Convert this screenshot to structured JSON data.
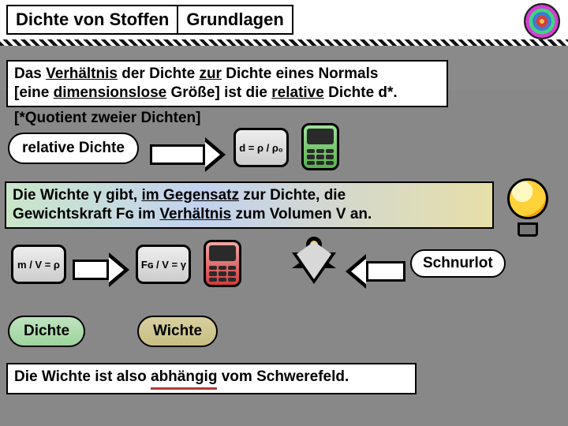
{
  "header": {
    "title_left": "Dichte von Stoffen",
    "title_right": "Grundlagen"
  },
  "intro": {
    "line1_a": "Das ",
    "line1_b": "Verhältnis",
    "line1_c": " der Dichte ",
    "line1_d": "zur",
    "line1_e": " Dichte eines Normals",
    "line2_a": "[eine ",
    "line2_b": "dimensionslose",
    "line2_c": " Größe] ist die ",
    "line2_d": "relative",
    "line2_e": " Dichte d*.",
    "line3": "[*Quotient zweier Dichten]"
  },
  "relbox": {
    "label": "relative Dichte"
  },
  "formulas": {
    "rel": "d = ρ / ρ₀",
    "dichte": "m / V = ρ",
    "wichte": "Fɢ / V = γ"
  },
  "wichte_def": {
    "a": "Die Wichte γ gibt, ",
    "b": "im Gegensatz",
    "c": " zur Dichte, die",
    "d": "Gewichtskraft Fɢ im ",
    "e": "Verhältnis",
    "f": " zum Volumen V an."
  },
  "labels": {
    "schnurlot": "Schnurlot",
    "dichte": "Dichte",
    "wichte": "Wichte"
  },
  "footer": {
    "a": "Die Wichte ist also ",
    "b": "abhängig",
    "c": " vom Schwerefeld."
  }
}
